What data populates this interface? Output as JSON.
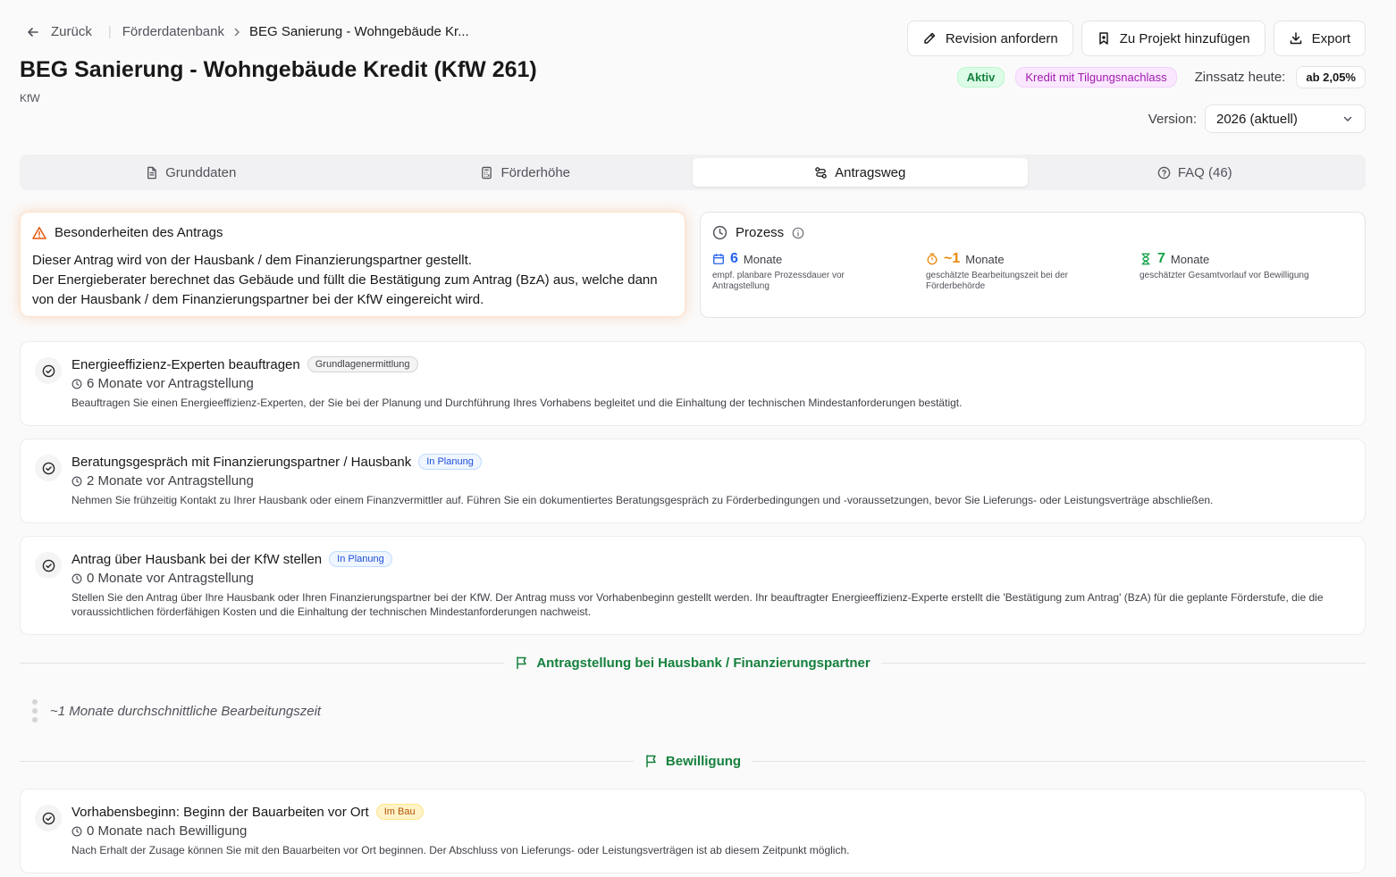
{
  "breadcrumb": {
    "back_label": "Zurück",
    "parent": "Förderdatenbank",
    "current": "BEG Sanierung - Wohngebäude Kr..."
  },
  "header": {
    "title": "BEG Sanierung - Wohngebäude Kredit (KfW 261)",
    "subtitle": "KfW"
  },
  "actions": {
    "revision": "Revision anfordern",
    "add_project": "Zu Projekt hinzufügen",
    "export": "Export"
  },
  "meta": {
    "status": "Aktiv",
    "type": "Kredit mit Tilgungsnachlass",
    "rate_label": "Zinssatz heute:",
    "rate_value": "ab 2,05%"
  },
  "version": {
    "label": "Version:",
    "selected": "2026 (aktuell)"
  },
  "tabs": [
    {
      "label": "Grunddaten",
      "icon": "document-icon"
    },
    {
      "label": "Förderhöhe",
      "icon": "calculator-icon"
    },
    {
      "label": "Antragsweg",
      "icon": "route-icon"
    },
    {
      "label": "FAQ (46)",
      "icon": "help-circle-icon"
    }
  ],
  "special": {
    "title": "Besonderheiten des Antrags",
    "line1": "Dieser Antrag wird von der Hausbank / dem Finanzierungspartner gestellt.",
    "line2": "Der Energieberater berechnet das Gebäude und füllt die Bestätigung zum Antrag (BzA) aus, welche dann von der Hausbank / dem Finanzierungspartner bei der KfW eingereicht wird."
  },
  "process": {
    "title": "Prozess",
    "items": [
      {
        "value": "6",
        "unit": "Monate",
        "desc": "empf. planbare Prozessdauer vor Antragstellung",
        "color": "#2563eb"
      },
      {
        "value": "~1",
        "unit": "Monate",
        "desc": "geschätzte Bearbeitungszeit bei der Förderbehörde",
        "color": "#ea8a0c"
      },
      {
        "value": "7",
        "unit": "Monate",
        "desc": "geschätzter Gesamtvorlauf vor Bewilligung",
        "color": "#16a34a"
      }
    ]
  },
  "steps": [
    {
      "title": "Energieeffizienz-Experten beauftragen",
      "tag": "Grundlagenermittlung",
      "time": "6 Monate vor Antragstellung",
      "desc": "Beauftragen Sie einen Energieeffizienz-Experten, der Sie bei der Planung und Durchführung Ihres Vorhabens begleitet und die Einhaltung der technischen Mindestanforderungen bestätigt."
    },
    {
      "title": "Beratungsgespräch mit Finanzierungspartner / Hausbank",
      "tag": "In Planung",
      "time": "2 Monate vor Antragstellung",
      "desc": "Nehmen Sie frühzeitig Kontakt zu Ihrer Hausbank oder einem Finanzvermittler auf. Führen Sie ein dokumentiertes Beratungsgespräch zu Förderbedingungen und -voraussetzungen, bevor Sie Lieferungs- oder Leistungsverträge abschließen."
    },
    {
      "title": "Antrag über Hausbank bei der KfW stellen",
      "tag": "In Planung",
      "time": "0 Monate vor Antragstellung",
      "desc": "Stellen Sie den Antrag über Ihre Hausbank oder Ihren Finanzierungspartner bei der KfW. Der Antrag muss vor Vorhabenbeginn gestellt werden. Ihr beauftragter Energieeffizienz-Experte erstellt die 'Bestätigung zum Antrag' (BzA) für die geplante Förderstufe, die die voraussichtlichen förderfähigen Kosten und die Einhaltung der technischen Mindestanforderungen nachweist."
    },
    {
      "title": "Vorhabensbeginn: Beginn der Bauarbeiten vor Ort",
      "tag": "Im Bau",
      "time": "0 Monate nach Bewilligung",
      "desc": "Nach Erhalt der Zusage können Sie mit den Bauarbeiten vor Ort beginnen. Der Abschluss von Lieferungs- oder Leistungsverträgen ist ab diesem Zeitpunkt möglich."
    }
  ],
  "milestones": {
    "application": "Antragstellung bei Hausbank / Finanzierungspartner",
    "approval": "Bewilligung"
  },
  "wait": {
    "text": "~1 Monate durchschnittliche Bearbeitungszeit"
  },
  "colors": {
    "accent_green": "#15803d",
    "warning_orange": "#ea580c",
    "primary_blue": "#2563eb"
  }
}
